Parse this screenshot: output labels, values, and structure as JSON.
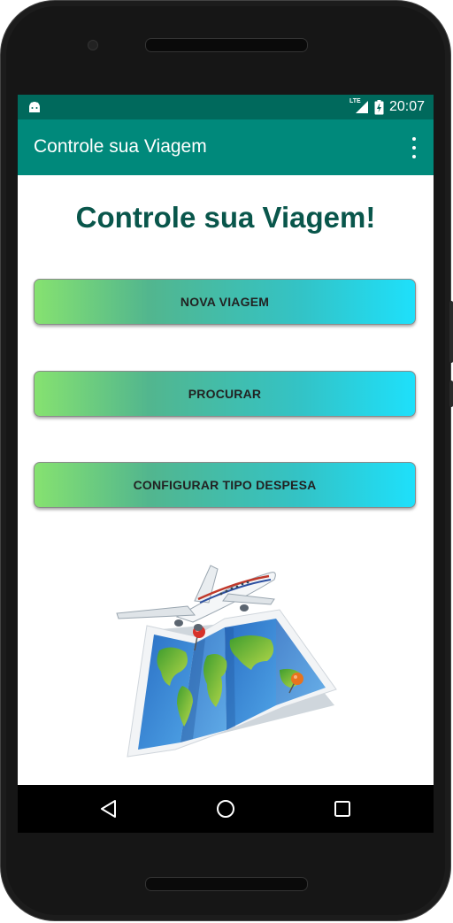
{
  "status_bar": {
    "network": "LTE",
    "time": "20:07",
    "icons": [
      "android-icon",
      "signal-icon",
      "battery-icon"
    ]
  },
  "app_bar": {
    "title": "Controle sua Viagem",
    "menu_icon": "overflow-menu-icon"
  },
  "main": {
    "heading": "Controle sua Viagem!",
    "buttons": [
      {
        "label": "NOVA VIAGEM"
      },
      {
        "label": "PROCURAR"
      },
      {
        "label": "CONFIGURAR TIPO DESPESA"
      }
    ],
    "illustration": "airplane-over-world-map-illustration"
  },
  "nav_bar": {
    "icons": [
      "back-icon",
      "home-icon",
      "recents-icon"
    ]
  },
  "colors": {
    "status_bar": "#00695c",
    "app_bar": "#00897b",
    "heading": "#09564b",
    "button_gradient_start": "#86e270",
    "button_gradient_end": "#1ee0fb"
  }
}
